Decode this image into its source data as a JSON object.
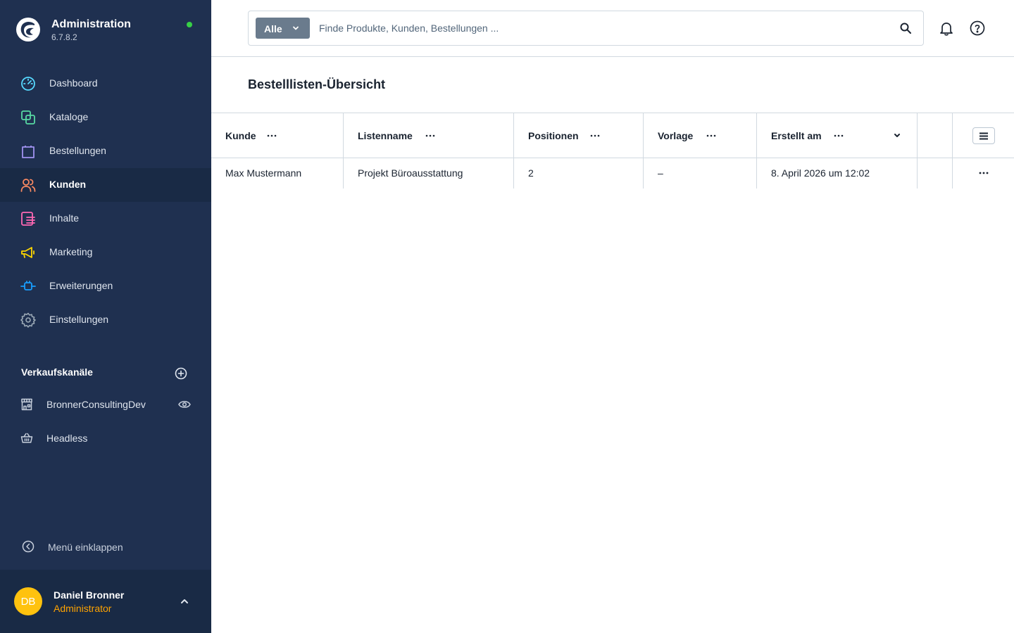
{
  "app": {
    "title": "Administration",
    "version": "6.7.8.2",
    "status_color": "#37d046"
  },
  "sidebar": {
    "items": [
      {
        "label": "Dashboard",
        "icon": "dashboard-icon",
        "color": "#57d9ff"
      },
      {
        "label": "Kataloge",
        "icon": "catalog-icon",
        "color": "#57d9a3"
      },
      {
        "label": "Bestellungen",
        "icon": "shopping-bag-icon",
        "color": "#a092f0"
      },
      {
        "label": "Kunden",
        "icon": "customers-icon",
        "color": "#f88962",
        "active": true
      },
      {
        "label": "Inhalte",
        "icon": "content-icon",
        "color": "#ff68b4"
      },
      {
        "label": "Marketing",
        "icon": "megaphone-icon",
        "color": "#ffd700"
      },
      {
        "label": "Erweiterungen",
        "icon": "plug-icon",
        "color": "#189eff"
      },
      {
        "label": "Einstellungen",
        "icon": "gear-icon",
        "color": "#9aa8b5"
      }
    ],
    "sales_channels": {
      "heading": "Verkaufskanäle",
      "channels": [
        {
          "label": "BronnerConsultingDev",
          "icon": "storefront-icon"
        },
        {
          "label": "Headless",
          "icon": "basket-icon"
        }
      ]
    },
    "collapse_label": "Menü einklappen",
    "user": {
      "initials": "DB",
      "name": "Daniel Bronner",
      "role": "Administrator",
      "avatar_color": "#ffc20e",
      "role_color": "#ffa300"
    }
  },
  "search": {
    "type_label": "Alle",
    "placeholder": "Finde Produkte, Kunden, Bestellungen ..."
  },
  "page": {
    "title": "Bestelllisten-Übersicht"
  },
  "grid": {
    "columns": [
      "Kunde",
      "Listenname",
      "Positionen",
      "Vorlage",
      "Erstellt am"
    ],
    "rows": [
      {
        "customer": "Max Mustermann",
        "list_name": "Projekt Büroausstattung",
        "positions": "2",
        "template": "–",
        "created": "8. April 2026 um 12:02"
      }
    ]
  }
}
